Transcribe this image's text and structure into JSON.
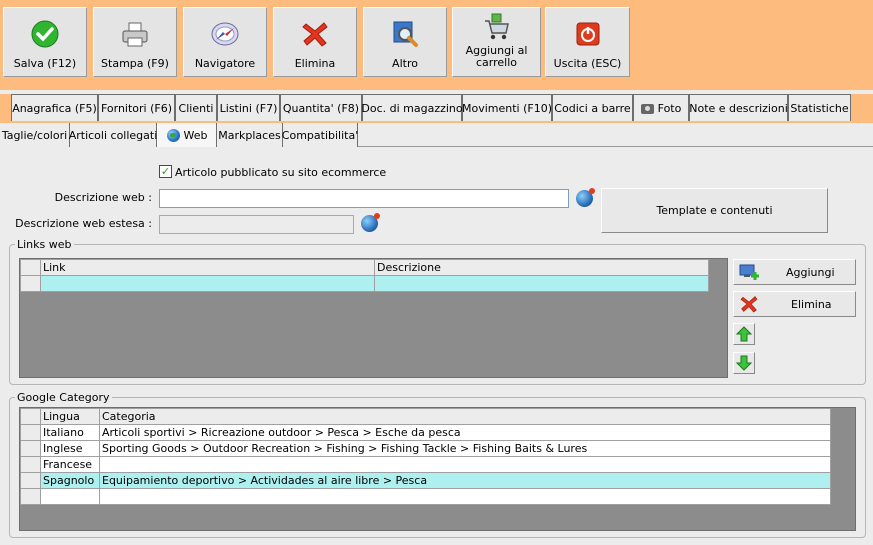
{
  "toolbar": {
    "buttons": [
      {
        "label": "Salva (F12)",
        "icon": "check-icon"
      },
      {
        "label": "Stampa (F9)",
        "icon": "printer-icon"
      },
      {
        "label": "Navigatore",
        "icon": "compass-icon"
      },
      {
        "label": "Elimina",
        "icon": "delete-x-icon"
      },
      {
        "label": "Altro",
        "icon": "magnifier-icon"
      },
      {
        "label": "Aggiungi al carrello",
        "icon": "cart-icon"
      },
      {
        "label": "Uscita (ESC)",
        "icon": "power-icon"
      }
    ]
  },
  "tabs_main": [
    "Anagrafica (F5)",
    "Fornitori (F6)",
    "Clienti",
    "Listini (F7)",
    "Quantita' (F8)",
    "Doc. di magazzino",
    "Movimenti (F10)",
    "Codici a barre",
    "Foto",
    "Note e descrizioni",
    "Statistiche"
  ],
  "tabs_sub": [
    "Taglie/colori",
    "Articoli collegati",
    "Web",
    "Markplaces",
    "Compatibilita'"
  ],
  "web": {
    "published_label": "Articolo pubblicato su sito ecommerce",
    "published_checked": true,
    "desc_label": "Descrizione web :",
    "desc_value": "",
    "desc_ext_label": "Descrizione web estesa :",
    "desc_ext_value": "",
    "template_button": "Template e contenuti"
  },
  "links": {
    "title": "Links web",
    "columns": [
      "Link",
      "Descrizione"
    ],
    "add_label": "Aggiungi",
    "delete_label": "Elimina"
  },
  "google": {
    "title": "Google Category",
    "columns": [
      "Lingua",
      "Categoria"
    ],
    "rows": [
      {
        "lang": "Italiano",
        "cat": "Articoli sportivi > Ricreazione outdoor > Pesca > Esche da pesca"
      },
      {
        "lang": "Inglese",
        "cat": "Sporting Goods > Outdoor Recreation > Fishing > Fishing Tackle > Fishing Baits & Lures"
      },
      {
        "lang": "Francese",
        "cat": ""
      },
      {
        "lang": "Spagnolo",
        "cat": "Equipamiento deportivo > Actividades al aire libre > Pesca"
      }
    ]
  }
}
